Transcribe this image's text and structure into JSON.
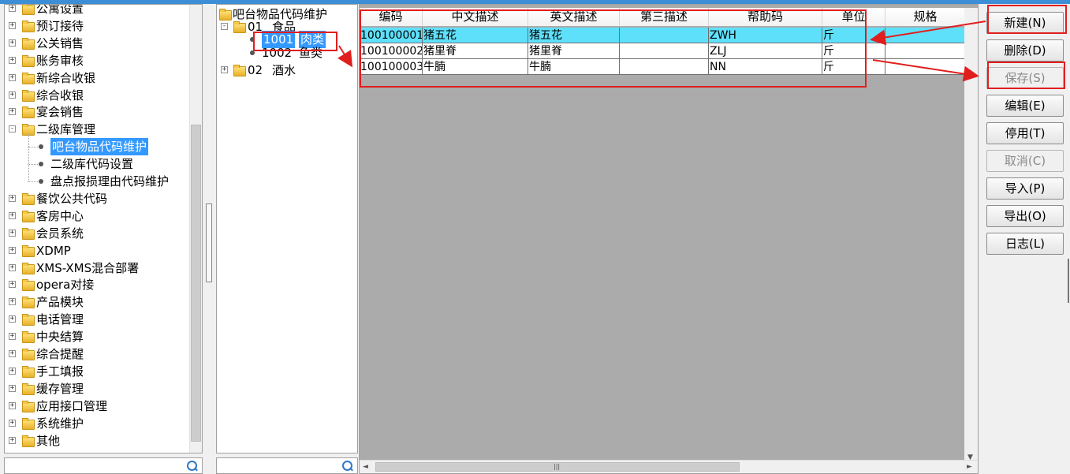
{
  "nav_tree": {
    "items": [
      {
        "label": "公寓设置",
        "expander": "+"
      },
      {
        "label": "预订接待",
        "expander": "+"
      },
      {
        "label": "公关销售",
        "expander": "+"
      },
      {
        "label": "账务审核",
        "expander": "+"
      },
      {
        "label": "新综合收银",
        "expander": "+"
      },
      {
        "label": "综合收银",
        "expander": "+"
      },
      {
        "label": "宴会销售",
        "expander": "+"
      },
      {
        "label": "二级库管理",
        "expander": "-"
      },
      {
        "label": "吧台物品代码维护",
        "child": true,
        "selected": true
      },
      {
        "label": "二级库代码设置",
        "child": true
      },
      {
        "label": "盘点报损理由代码维护",
        "child": true
      },
      {
        "label": "餐饮公共代码",
        "expander": "+"
      },
      {
        "label": "客房中心",
        "expander": "+"
      },
      {
        "label": "会员系统",
        "expander": "+"
      },
      {
        "label": "XDMP",
        "expander": "+"
      },
      {
        "label": "XMS-XMS混合部署",
        "expander": "+"
      },
      {
        "label": "opera对接",
        "expander": "+"
      },
      {
        "label": "产品模块",
        "expander": "+"
      },
      {
        "label": "电话管理",
        "expander": "+"
      },
      {
        "label": "中央结算",
        "expander": "+"
      },
      {
        "label": "综合提醒",
        "expander": "+"
      },
      {
        "label": "手工填报",
        "expander": "+"
      },
      {
        "label": "缓存管理",
        "expander": "+"
      },
      {
        "label": "应用接口管理",
        "expander": "+"
      },
      {
        "label": "系统维护",
        "expander": "+"
      },
      {
        "label": "其他",
        "expander": "+"
      }
    ],
    "search_value": ""
  },
  "category_tree": {
    "root": "吧台物品代码维护",
    "nodes": [
      {
        "code": "01",
        "name": "食品",
        "expander": "-"
      },
      {
        "code": "1001",
        "name": "肉类",
        "child": true,
        "selected": true
      },
      {
        "code": "1002",
        "name": "鱼类",
        "child": true
      },
      {
        "code": "02",
        "name": "酒水",
        "expander": "+"
      }
    ],
    "search_value": ""
  },
  "grid": {
    "columns": [
      "编码",
      "中文描述",
      "英文描述",
      "第三描述",
      "帮助码",
      "单位",
      "规格"
    ],
    "rows": [
      [
        "100100001",
        "猪五花",
        "猪五花",
        "",
        "ZWH",
        "斤",
        ""
      ],
      [
        "100100002",
        "猪里脊",
        "猪里脊",
        "",
        "ZLJ",
        "斤",
        ""
      ],
      [
        "100100003",
        "牛腩",
        "牛腩",
        "",
        "NN",
        "斤",
        ""
      ]
    ]
  },
  "buttons": {
    "new": "新建(N)",
    "delete": "删除(D)",
    "save": "保存(S)",
    "edit": "编辑(E)",
    "disable": "停用(T)",
    "cancel": "取消(C)",
    "import": "导入(P)",
    "export": "导出(O)",
    "log": "日志(L)"
  },
  "colors": {
    "selection": "#3399ff",
    "active_row": "#5ee0fb",
    "annotation": "#e11e1e"
  }
}
